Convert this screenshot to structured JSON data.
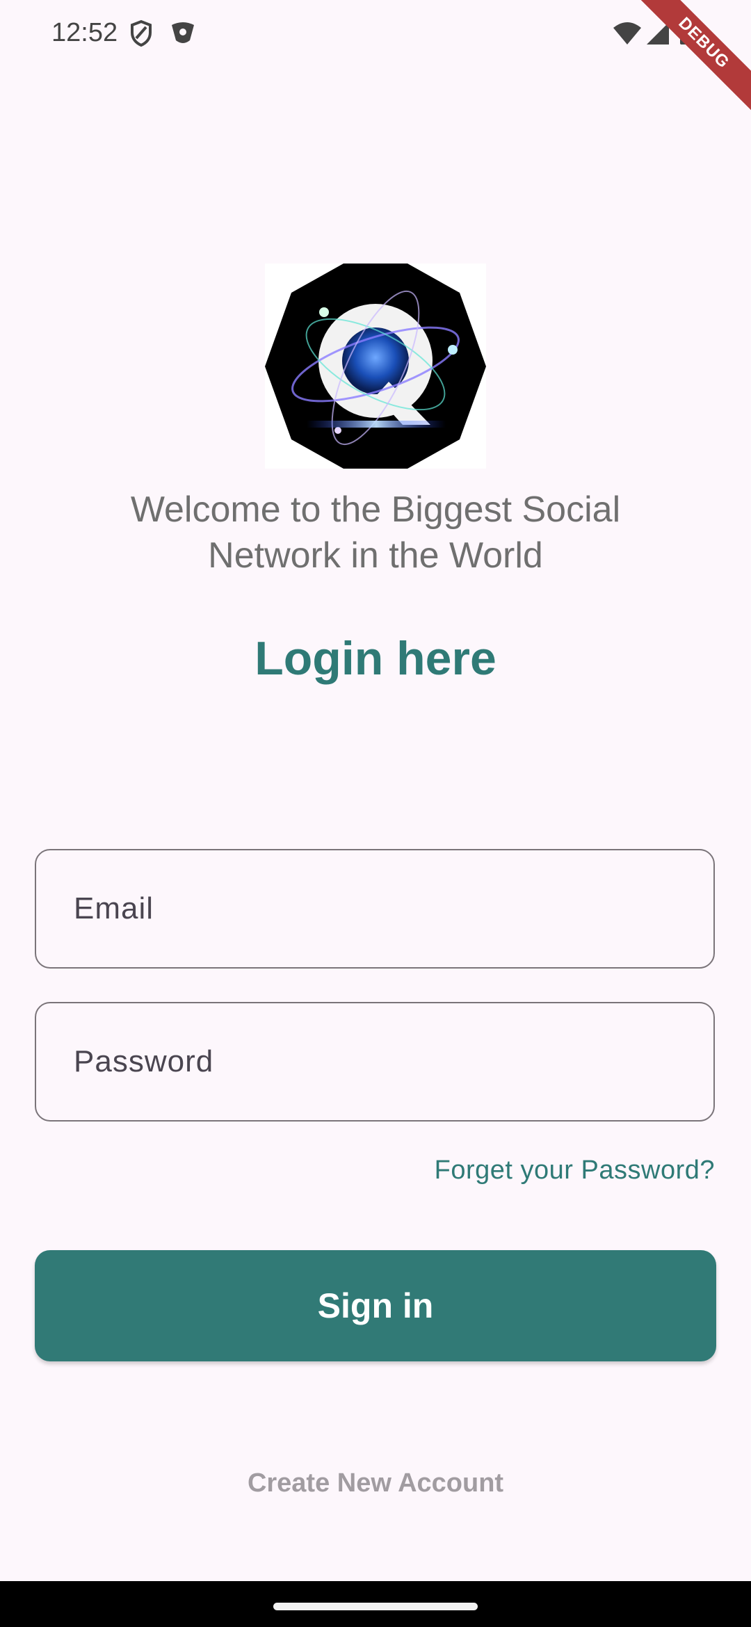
{
  "status_bar": {
    "time": "12:52",
    "icons": [
      "shield-icon",
      "vpn-icon",
      "wifi-icon",
      "signal-icon",
      "battery-icon"
    ]
  },
  "debug_banner": "DEBUG",
  "welcome_text": "Welcome to the Biggest Social Network in the World",
  "welcome_line1": "Welcome to the Biggest Social",
  "welcome_line2": "Network in the World",
  "title": "Login here",
  "email": {
    "placeholder": "Email",
    "value": ""
  },
  "password": {
    "placeholder": "Password",
    "value": ""
  },
  "forgot_password": "Forget your Password?",
  "sign_in_label": "Sign in",
  "create_account_label": "Create New Account",
  "colors": {
    "background": "#fdf7fc",
    "accent": "#317a76",
    "title": "#2f7a76",
    "muted_text": "#6f6f6f",
    "link_muted": "#a19ca1"
  }
}
